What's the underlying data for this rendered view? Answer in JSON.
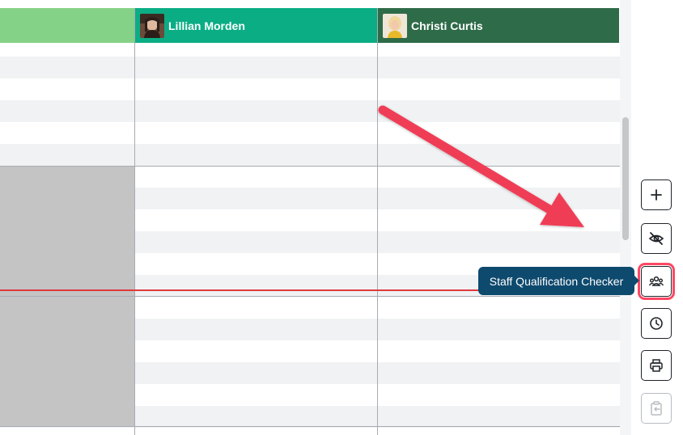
{
  "columns": [
    {
      "name": "",
      "color": "#84d287"
    },
    {
      "name": "Lillian Morden",
      "color": "#0bad85",
      "avatar": "avatar-woman-dark-hair"
    },
    {
      "name": "Christi Curtis",
      "color": "#2e6b48",
      "avatar": "avatar-woman-blonde"
    }
  ],
  "toolbar": {
    "buttons": [
      {
        "icon": "plus-icon",
        "enabled": true
      },
      {
        "icon": "eye-off-icon",
        "enabled": true
      },
      {
        "icon": "staff-qualification-icon",
        "enabled": true,
        "highlighted": true
      },
      {
        "icon": "clock-icon",
        "enabled": true
      },
      {
        "icon": "print-icon",
        "enabled": true
      },
      {
        "icon": "clipboard-import-icon",
        "enabled": false
      }
    ],
    "tooltip": "Staff Qualification Checker"
  },
  "annotation": {
    "type": "arrow",
    "color": "#f03d57"
  },
  "colors": {
    "now_line": "#e0393d",
    "blocked": "#c4c4c4",
    "row_shade": "#f1f2f4"
  }
}
